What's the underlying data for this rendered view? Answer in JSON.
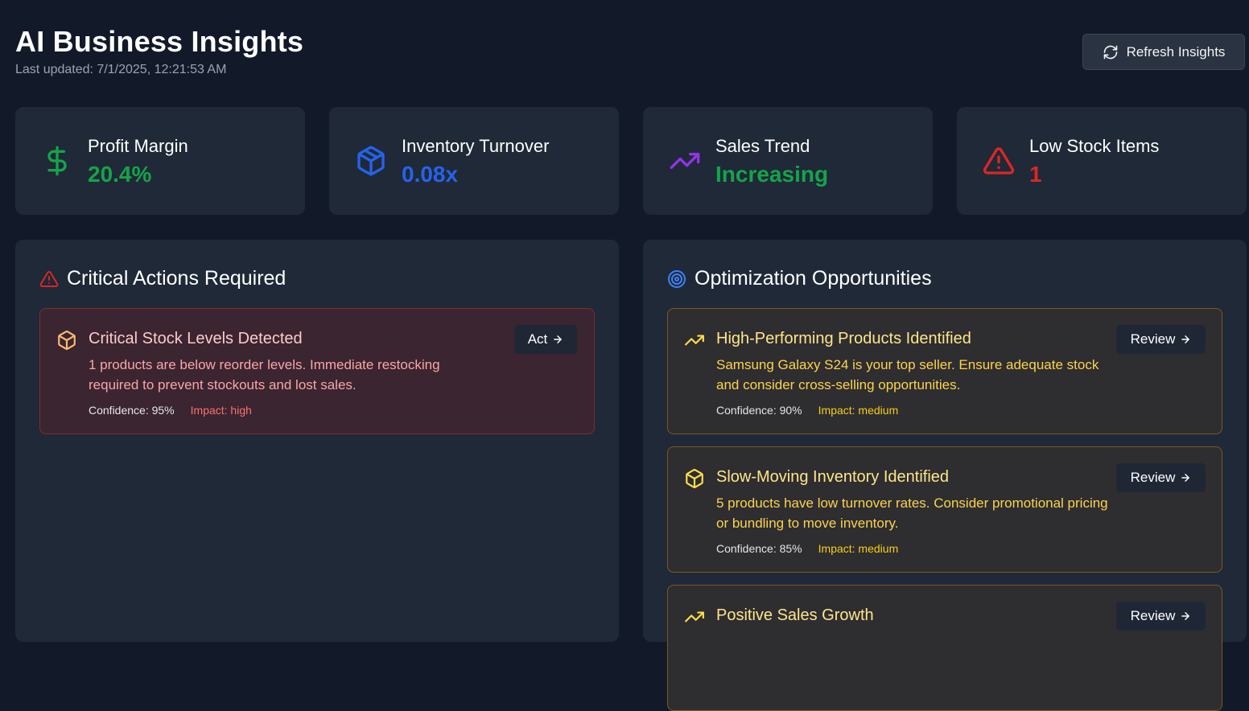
{
  "header": {
    "title": "AI Business Insights",
    "last_updated": "Last updated: 7/1/2025, 12:21:53 AM",
    "refresh_label": "Refresh Insights"
  },
  "stats": [
    {
      "label": "Profit Margin",
      "value": "20.4%",
      "icon": "dollar-icon",
      "color": "#16a34a"
    },
    {
      "label": "Inventory Turnover",
      "value": "0.08x",
      "icon": "package-icon",
      "color": "#2563eb"
    },
    {
      "label": "Sales Trend",
      "value": "Increasing",
      "icon": "trending-up-icon",
      "color": "#16a34a",
      "icon_color": "#9333ea"
    },
    {
      "label": "Low Stock Items",
      "value": "1",
      "icon": "alert-triangle-icon",
      "color": "#dc2626"
    }
  ],
  "critical": {
    "title": "Critical Actions Required",
    "items": [
      {
        "title": "Critical Stock Levels Detected",
        "description": "1 products are below reorder levels. Immediate restocking required to prevent stockouts and lost sales.",
        "confidence": "Confidence: 95%",
        "impact": "Impact: high",
        "action": "Act"
      }
    ]
  },
  "optimization": {
    "title": "Optimization Opportunities",
    "items": [
      {
        "title": "High-Performing Products Identified",
        "description": "Samsung Galaxy S24 is your top seller. Ensure adequate stock and consider cross-selling opportunities.",
        "confidence": "Confidence: 90%",
        "impact": "Impact: medium",
        "action": "Review"
      },
      {
        "title": "Slow-Moving Inventory Identified",
        "description": "5 products have low turnover rates. Consider promotional pricing or bundling to move inventory.",
        "confidence": "Confidence: 85%",
        "impact": "Impact: medium",
        "action": "Review"
      },
      {
        "title": "Positive Sales Growth",
        "action": "Review"
      }
    ]
  }
}
